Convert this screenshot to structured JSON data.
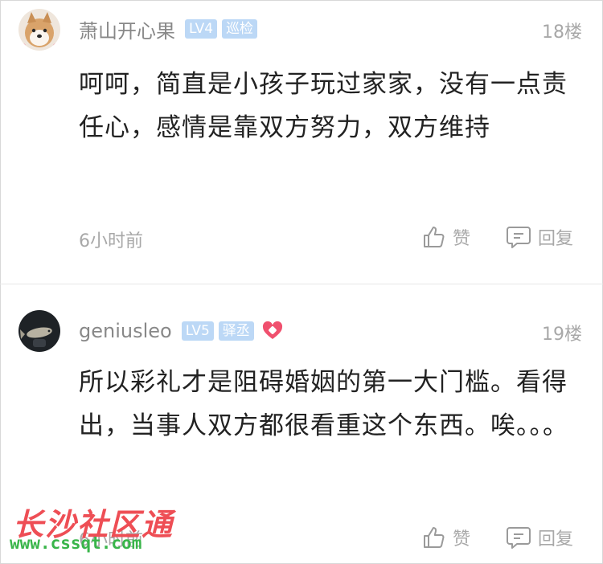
{
  "comments": [
    {
      "username": "萧山开心果",
      "badges": [
        "LV4",
        "巡检"
      ],
      "floor": "18楼",
      "content": "呵呵，简直是小孩子玩过家家，没有一点责任心，感情是靠双方努力，双方维持",
      "time": "6小时前",
      "like_label": "赞",
      "reply_label": "回复",
      "avatar_icon": "shiba-dog-avatar"
    },
    {
      "username": "geniusleo",
      "badges": [
        "LV5",
        "驿丞"
      ],
      "floor": "19楼",
      "content": "所以彩礼才是阻碍婚姻的第一大门槛。看得出，当事人双方都很看重这个东西。唉。。。",
      "time": "6小时前",
      "like_label": "赞",
      "reply_label": "回复",
      "avatar_icon": "fish-photo-avatar",
      "extra_icon": "heart-badge-icon"
    }
  ],
  "watermark": {
    "title": "长沙社区通",
    "url": "www.cssqt.com"
  },
  "colors": {
    "badge": "#bcd8f6",
    "muted_text": "#a8a8a8",
    "heart": "#f0506e",
    "watermark_red": "#ee4e55",
    "watermark_green": "#39b54a"
  }
}
